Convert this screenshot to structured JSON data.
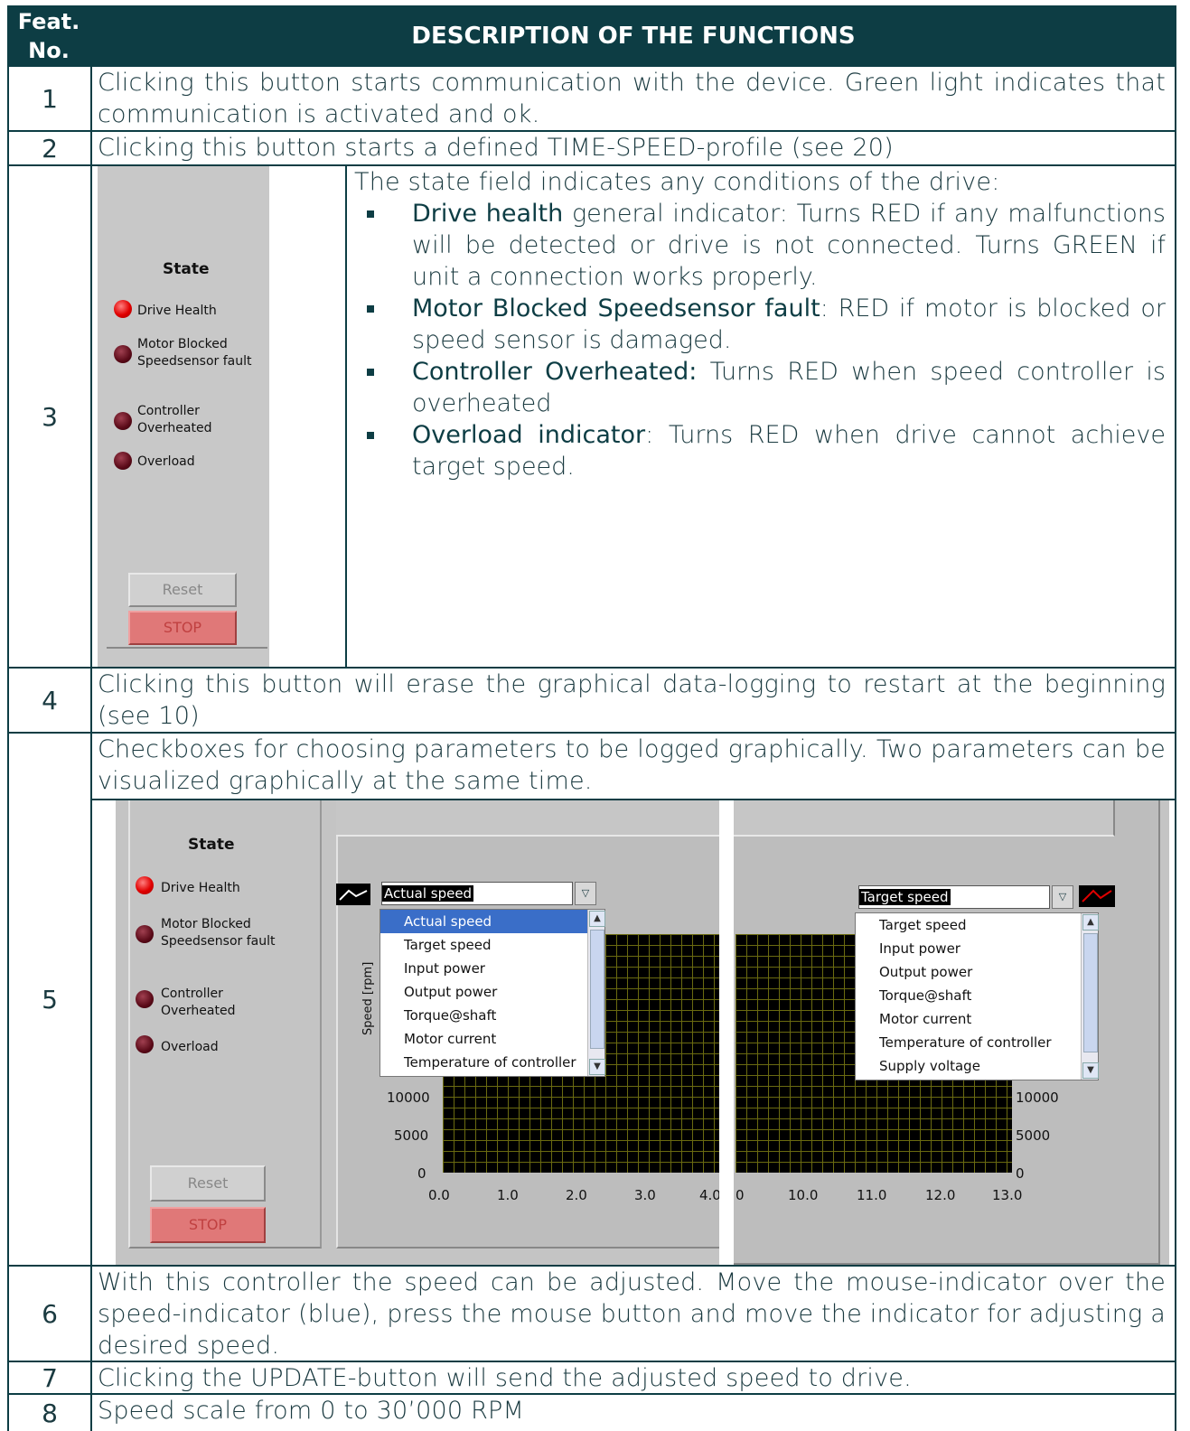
{
  "header": {
    "no_line1": "Feat.",
    "no_line2": "No.",
    "title": "DESCRIPTION OF THE FUNCTIONS"
  },
  "rows": {
    "r1": {
      "num": "1",
      "text": "Clicking this button starts communication with the device. Green light indicates that communication is activated and ok."
    },
    "r2": {
      "num": "2",
      "text": "Clicking this button starts a defined TIME-SPEED-profile (see 20)"
    },
    "r3": {
      "num": "3",
      "intro": "The state field indicates any conditions of the drive:",
      "b1_key": "Drive health",
      "b1_text": " general indicator: Turns RED if any  malfunctions will be detected or drive is not connected. Turns GREEN if unit a connection works properly.",
      "b2_key": "Motor Blocked Speedsensor fault",
      "b2_text": ": RED if motor is blocked or speed sensor is damaged.",
      "b3_key": "Controller Overheated:",
      "b3_text": " Turns RED when speed controller is overheated",
      "b4_key": "Overload indicator",
      "b4_text": ": Turns RED when drive cannot achieve target speed."
    },
    "r4": {
      "num": "4",
      "text": "Clicking this button will erase the graphical data-logging to restart at the beginning (see 10)"
    },
    "r5": {
      "num": "5",
      "text": "Checkboxes for choosing parameters to be logged graphically. Two parameters can be visualized graphically at the same time."
    },
    "r6": {
      "num": "6",
      "text": "With this controller the speed can be adjusted. Move the mouse-indicator over the speed-indicator (blue), press the mouse button and move the indicator for adjusting a desired speed."
    },
    "r7": {
      "num": "7",
      "text": "Clicking the UPDATE-button will send the adjusted speed to drive."
    },
    "r8": {
      "num": "8",
      "text": "Speed scale from 0 to 30’000 RPM"
    }
  },
  "state_panel": {
    "title": "State",
    "drive_health": "Drive Health",
    "motor_blocked_1": "Motor Blocked",
    "motor_blocked_2": "Speedsensor fault",
    "controller_1": "Controller",
    "controller_2": "Overheated",
    "overload": "Overload",
    "reset": "Reset",
    "stop": "STOP"
  },
  "graph_left": {
    "selected": "Actual speed",
    "options": [
      "Actual speed",
      "Target speed",
      "Input power",
      "Output power",
      "Torque@shaft",
      "Motor current",
      "Temperature of controller"
    ],
    "ylabel": "Speed [rpm]",
    "yticks": [
      "10000",
      "5000",
      "0"
    ],
    "xticks": [
      "0.0",
      "1.0",
      "2.0",
      "3.0",
      "4.0"
    ]
  },
  "graph_right": {
    "selected": "Target speed",
    "options": [
      "Target speed",
      "Input power",
      "Output power",
      "Torque@shaft",
      "Motor current",
      "Temperature of controller",
      "Supply voltage"
    ],
    "yticks": [
      "10000",
      "5000",
      "0"
    ],
    "xticks": [
      "0",
      "10.0",
      "11.0",
      "12.0",
      "13.0"
    ]
  },
  "colors": {
    "header_bg": "#0d3d44",
    "led_red": "#e00000",
    "highlight": "#3a6ec8"
  }
}
